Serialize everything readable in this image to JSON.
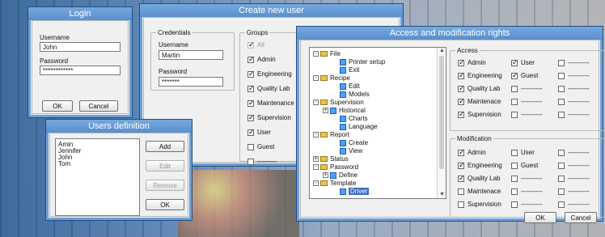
{
  "login": {
    "title": "Login",
    "username_label": "Username",
    "username_value": "John",
    "password_label": "Password",
    "password_value": "************",
    "ok": "OK",
    "cancel": "Cancel"
  },
  "users_definition": {
    "title": "Users definition",
    "users": [
      "Amin",
      "Jennifer",
      "John",
      "Tom"
    ],
    "add": "Add",
    "edit": "Edit",
    "remove": "Remove",
    "ok": "OK"
  },
  "create_user": {
    "title": "Create new user",
    "credentials_label": "Credentials",
    "username_label": "Username",
    "username_value": "Martin",
    "password_label": "Password",
    "password_value": "*******",
    "groups_label": "Groups",
    "groups": [
      {
        "label": "All",
        "checked": true,
        "disabled": true
      },
      {
        "label": "Admin",
        "checked": true,
        "disabled": false
      },
      {
        "label": "Engineering",
        "checked": true,
        "disabled": false
      },
      {
        "label": "Quality Lab",
        "checked": true,
        "disabled": false
      },
      {
        "label": "Maintenance",
        "checked": true,
        "disabled": false
      },
      {
        "label": "Supervision",
        "checked": true,
        "disabled": false
      },
      {
        "label": "User",
        "checked": true,
        "disabled": false
      },
      {
        "label": "Guest",
        "checked": false,
        "disabled": false
      },
      {
        "label": "---------",
        "checked": false,
        "disabled": false
      }
    ]
  },
  "access_rights": {
    "title": "Access and modification rights",
    "tree": [
      {
        "label": "File",
        "type": "folder",
        "level": 0,
        "expander": "-"
      },
      {
        "label": "Printer setup",
        "type": "doc",
        "level": 2
      },
      {
        "label": "Exit",
        "type": "doc",
        "level": 2
      },
      {
        "label": "Recipe",
        "type": "folder",
        "level": 0,
        "expander": "-"
      },
      {
        "label": "Edit",
        "type": "doc",
        "level": 2
      },
      {
        "label": "Models",
        "type": "doc",
        "level": 2
      },
      {
        "label": "Supervision",
        "type": "folder",
        "level": 0,
        "expander": "-"
      },
      {
        "label": "Historical",
        "type": "doc",
        "level": 1,
        "expander": "+"
      },
      {
        "label": "Charts",
        "type": "doc",
        "level": 2
      },
      {
        "label": "Language",
        "type": "doc",
        "level": 2
      },
      {
        "label": "Report",
        "type": "folder",
        "level": 0,
        "expander": "-"
      },
      {
        "label": "Create",
        "type": "doc",
        "level": 2
      },
      {
        "label": "View",
        "type": "doc",
        "level": 2
      },
      {
        "label": "Status",
        "type": "folder",
        "level": 0,
        "expander": "+"
      },
      {
        "label": "Password",
        "type": "folder",
        "level": 0,
        "expander": "-"
      },
      {
        "label": "Define",
        "type": "doc",
        "level": 1,
        "expander": "+"
      },
      {
        "label": "Template",
        "type": "folder",
        "level": 0,
        "expander": "-"
      },
      {
        "label": "Driver",
        "type": "doc",
        "level": 2
      }
    ],
    "access_label": "Access",
    "access_left": [
      {
        "label": "Admin",
        "checked": true
      },
      {
        "label": "Engineering",
        "checked": true
      },
      {
        "label": "Quality Lab",
        "checked": true
      },
      {
        "label": "Maintenace",
        "checked": true
      },
      {
        "label": "Supervision",
        "checked": true
      }
    ],
    "access_mid": [
      {
        "label": "User",
        "checked": true
      },
      {
        "label": "Guest",
        "checked": true
      },
      {
        "label": "----------",
        "checked": false
      },
      {
        "label": "----------",
        "checked": false
      },
      {
        "label": "----------",
        "checked": false
      }
    ],
    "access_right": [
      {
        "label": "----------",
        "checked": false
      },
      {
        "label": "----------",
        "checked": false
      },
      {
        "label": "----------",
        "checked": false
      },
      {
        "label": "----------",
        "checked": false
      },
      {
        "label": "----------",
        "checked": false
      }
    ],
    "mod_label": "Modification",
    "mod_left": [
      {
        "label": "Admin",
        "checked": true
      },
      {
        "label": "Engineering",
        "checked": true
      },
      {
        "label": "Quality Lab",
        "checked": true
      },
      {
        "label": "Maintenace",
        "checked": false
      },
      {
        "label": "Supervision",
        "checked": false
      }
    ],
    "mod_mid": [
      {
        "label": "User",
        "checked": false
      },
      {
        "label": "Guest",
        "checked": false
      },
      {
        "label": "----------",
        "checked": false
      },
      {
        "label": "----------",
        "checked": false
      },
      {
        "label": "----------",
        "checked": false
      }
    ],
    "mod_right": [
      {
        "label": "----------",
        "checked": false
      },
      {
        "label": "----------",
        "checked": false
      },
      {
        "label": "----------",
        "checked": false
      },
      {
        "label": "----------",
        "checked": false
      },
      {
        "label": "----------",
        "checked": false
      }
    ],
    "ok": "OK",
    "cancel": "Cancel"
  }
}
